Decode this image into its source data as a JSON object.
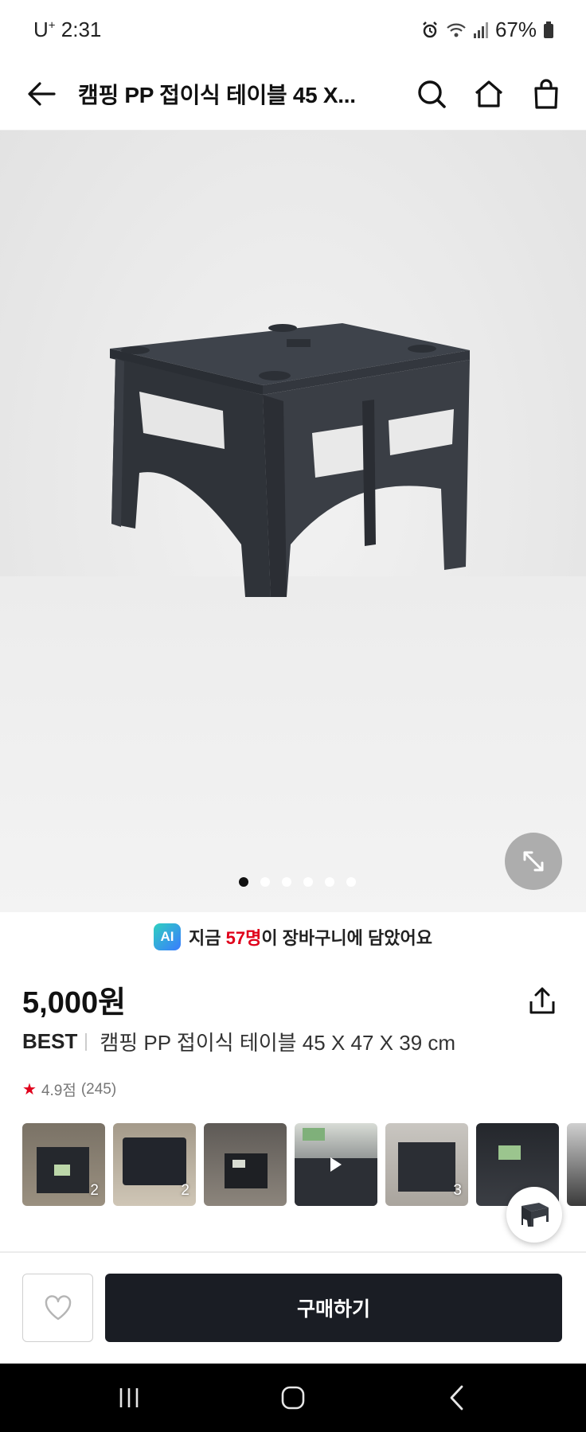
{
  "status_bar": {
    "carrier": "U",
    "carrier_sup": "+",
    "time": "2:31",
    "battery": "67%"
  },
  "header": {
    "title": "캠핑 PP 접이식 테이블 45 X...",
    "icons": [
      "back-arrow-icon",
      "search-icon",
      "home-icon",
      "shopping-bag-icon"
    ]
  },
  "product": {
    "image_pagination": {
      "total": 6,
      "active_index": 0
    }
  },
  "cart_banner": {
    "ai_badge": "AI",
    "prefix": "지금 ",
    "count": "57명",
    "suffix": "이 장바구니에 담았어요",
    "accent_color": "#e0001b"
  },
  "price": "5,000원",
  "brand": "BEST",
  "product_name": "캠핑 PP 접이식 테이블 45 X 47 X 39 cm",
  "rating": {
    "score": "4.9점",
    "count": "(245)"
  },
  "review_thumbnails": [
    {
      "count": "2"
    },
    {
      "count": "2"
    },
    {
      "count": ""
    },
    {
      "count": "",
      "video": true
    },
    {
      "count": "3"
    },
    {
      "count": ""
    }
  ],
  "bottom_bar": {
    "buy_label": "구매하기",
    "buy_color": "#1a1d24"
  }
}
